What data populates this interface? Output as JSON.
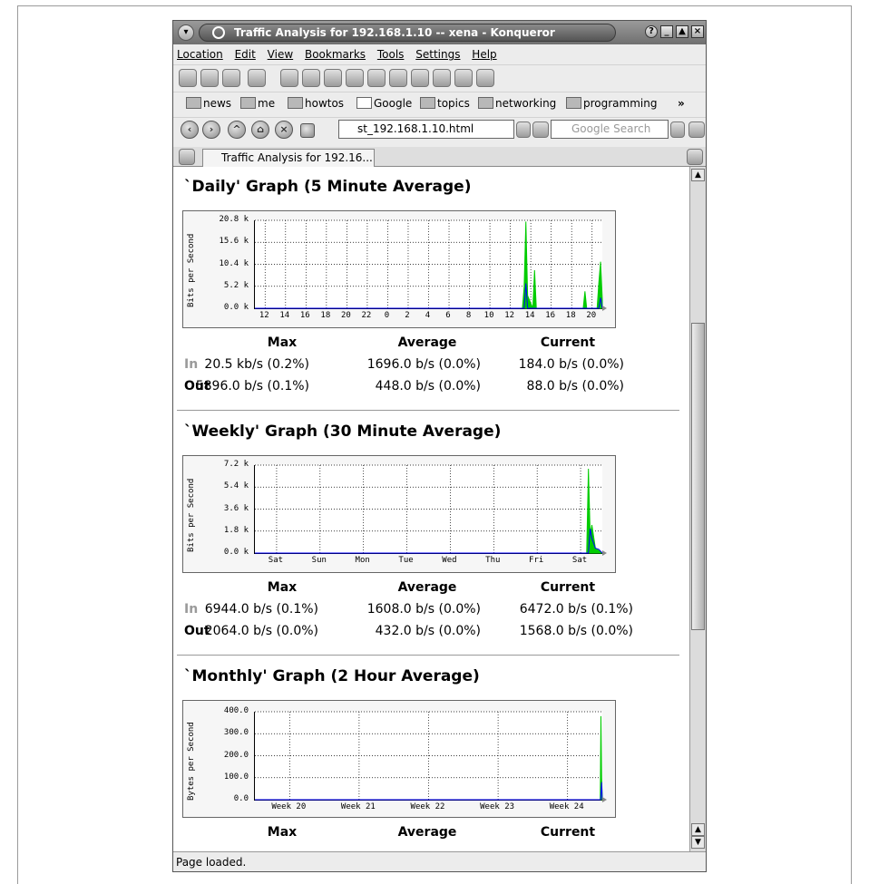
{
  "window": {
    "title": "Traffic Analysis for 192.168.1.10 -- xena - Konqueror",
    "help_icon": "?",
    "status": "Page loaded."
  },
  "menu": [
    "Location",
    "Edit",
    "View",
    "Bookmarks",
    "Tools",
    "Settings",
    "Help"
  ],
  "bookmarks": [
    "news",
    "me",
    "howtos",
    "Google",
    "topics",
    "networking",
    "programming"
  ],
  "bookmarks_more": "»",
  "url": "st_192.168.1.10.html",
  "search_placeholder": "Google Search",
  "tab_label": "Traffic Analysis for 192.16...",
  "stats_headers": {
    "max": "Max",
    "avg": "Average",
    "cur": "Current"
  },
  "row_labels": {
    "in": "In",
    "out": "Out"
  },
  "colors": {
    "in_label": "#9a9a9a",
    "in_series": "#00cc00",
    "out_series": "#0000ff"
  },
  "sections": [
    {
      "title": "`Daily' Graph (5 Minute Average)",
      "ylabel": "Bits per Second",
      "in": {
        "max": "20.5 kb/s (0.2%)",
        "avg": "1696.0 b/s (0.0%)",
        "cur": "184.0 b/s (0.0%)"
      },
      "out": {
        "max": "5896.0 b/s (0.1%)",
        "avg": "448.0 b/s (0.0%)",
        "cur": "88.0 b/s (0.0%)"
      }
    },
    {
      "title": "`Weekly' Graph (30 Minute Average)",
      "ylabel": "Bits per Second",
      "in": {
        "max": "6944.0 b/s (0.1%)",
        "avg": "1608.0 b/s (0.0%)",
        "cur": "6472.0 b/s (0.1%)"
      },
      "out": {
        "max": "2064.0 b/s (0.0%)",
        "avg": "432.0 b/s (0.0%)",
        "cur": "1568.0 b/s (0.0%)"
      }
    },
    {
      "title": "`Monthly' Graph (2 Hour Average)",
      "ylabel": "Bytes per Second"
    }
  ],
  "chart_data": [
    {
      "type": "area",
      "ylabel": "Bits per Second",
      "yticks": [
        "0.0 k",
        "5.2 k",
        "10.4 k",
        "15.6 k",
        "20.8 k"
      ],
      "ylim": [
        0,
        20.8
      ],
      "x_categories": [
        "12",
        "14",
        "16",
        "18",
        "20",
        "22",
        "0",
        "2",
        "4",
        "6",
        "8",
        "10",
        "12",
        "14",
        "16",
        "18",
        "20"
      ],
      "series": [
        {
          "color": "in",
          "x": [
            0,
            0.77,
            0.775,
            0.78,
            0.785,
            0.8,
            0.805,
            0.81,
            0.945,
            0.95,
            0.955,
            0.985,
            0.99,
            0.995,
            1.0
          ],
          "values": [
            0,
            0,
            5,
            20.5,
            3,
            0,
            9,
            0,
            0,
            4,
            0,
            0,
            6,
            11,
            2
          ]
        },
        {
          "color": "out",
          "x": [
            0,
            0.775,
            0.78,
            0.785,
            0.79,
            0.99,
            0.995,
            1.0
          ],
          "values": [
            0,
            0,
            5.9,
            0,
            0,
            0,
            2.5,
            0
          ]
        }
      ],
      "grid": true
    },
    {
      "type": "area",
      "ylabel": "Bits per Second",
      "yticks": [
        "0.0 k",
        "1.8 k",
        "3.6 k",
        "5.4 k",
        "7.2 k"
      ],
      "ylim": [
        0,
        7.2
      ],
      "x_categories": [
        "Sat",
        "Sun",
        "Mon",
        "Tue",
        "Wed",
        "Thu",
        "Fri",
        "Sat"
      ],
      "series": [
        {
          "color": "in",
          "x": [
            0,
            0.955,
            0.96,
            0.965,
            0.97,
            0.98,
            0.99,
            1.0
          ],
          "values": [
            0,
            0,
            6.9,
            1.5,
            2.3,
            0.4,
            0.2,
            0
          ]
        },
        {
          "color": "out",
          "x": [
            0,
            0.96,
            0.965,
            0.97,
            0.98,
            0.99,
            1.0
          ],
          "values": [
            0,
            0,
            2.0,
            1.2,
            0.4,
            0.3,
            0
          ]
        }
      ],
      "grid": true
    },
    {
      "type": "area",
      "ylabel": "Bytes per Second",
      "yticks": [
        "0.0",
        "100.0",
        "200.0",
        "300.0",
        "400.0"
      ],
      "ylim": [
        0,
        400
      ],
      "x_categories": [
        "Week 20",
        "Week 21",
        "Week 22",
        "Week 23",
        "Week 24"
      ],
      "series": [
        {
          "color": "in",
          "x": [
            0,
            0.994,
            0.996,
            0.998,
            1.0
          ],
          "values": [
            0,
            0,
            380,
            100,
            0
          ]
        },
        {
          "color": "out",
          "x": [
            0,
            0.995,
            0.998,
            1.0
          ],
          "values": [
            0,
            0,
            80,
            0
          ]
        }
      ],
      "grid": true
    }
  ]
}
